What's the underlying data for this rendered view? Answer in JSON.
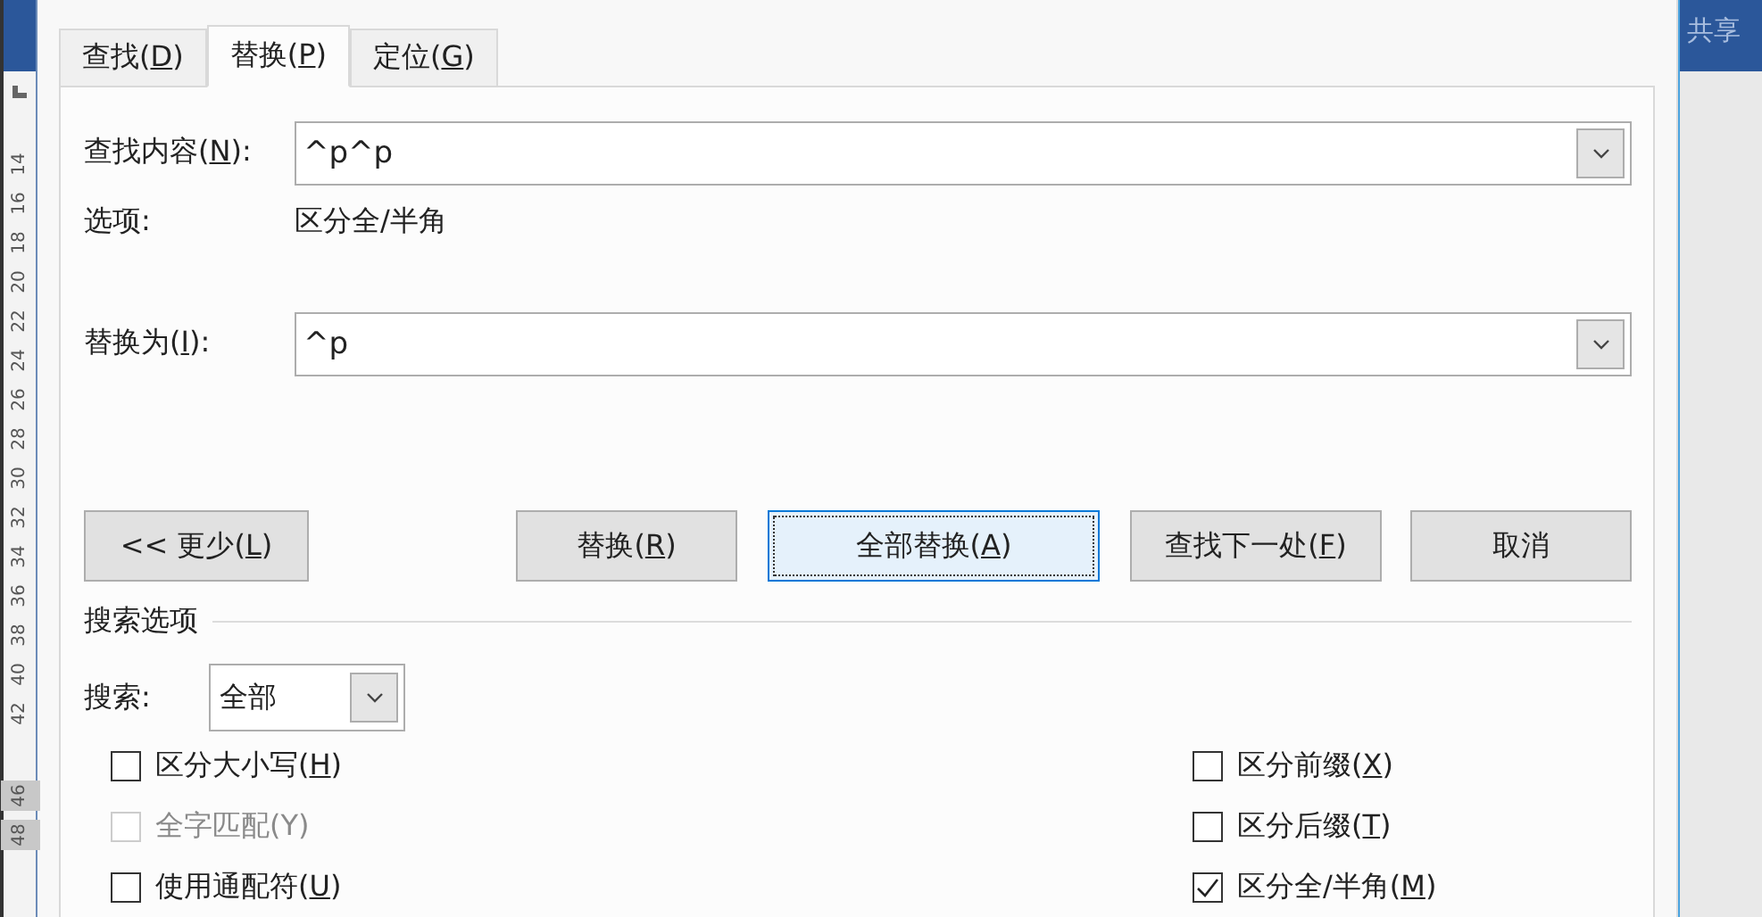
{
  "app_bar": {
    "share": "共享"
  },
  "ruler": [
    {
      "label": "14",
      "shaded": false
    },
    {
      "label": "16",
      "shaded": false
    },
    {
      "label": "18",
      "shaded": false
    },
    {
      "label": "20",
      "shaded": false
    },
    {
      "label": "22",
      "shaded": false
    },
    {
      "label": "24",
      "shaded": false
    },
    {
      "label": "26",
      "shaded": false
    },
    {
      "label": "28",
      "shaded": false
    },
    {
      "label": "30",
      "shaded": false
    },
    {
      "label": "32",
      "shaded": false
    },
    {
      "label": "34",
      "shaded": false
    },
    {
      "label": "36",
      "shaded": false
    },
    {
      "label": "38",
      "shaded": false
    },
    {
      "label": "40",
      "shaded": false
    },
    {
      "label": "42",
      "shaded": false
    },
    {
      "label": "46",
      "shaded": true
    },
    {
      "label": "48",
      "shaded": true
    }
  ],
  "tabs": [
    {
      "label": "查找(D)",
      "selected": false
    },
    {
      "label": "替换(P)",
      "selected": true
    },
    {
      "label": "定位(G)",
      "selected": false
    }
  ],
  "find": {
    "label": "查找内容(N):",
    "value": "^p^p"
  },
  "options": {
    "label": "选项:",
    "value": "区分全/半角"
  },
  "replace": {
    "label": "替换为(I):",
    "value": "^p"
  },
  "buttons": [
    {
      "label": "<< 更少(L)",
      "focused": false
    },
    {
      "label": "替换(R)",
      "focused": false
    },
    {
      "label": "全部替换(A)",
      "focused": true
    },
    {
      "label": "查找下一处(F)",
      "focused": false
    },
    {
      "label": "取消",
      "focused": false
    }
  ],
  "search_options": {
    "heading": "搜索选项",
    "search_label": "搜索:",
    "search_value": "全部"
  },
  "checkboxes_left": [
    {
      "label": "区分大小写(H)",
      "checked": false,
      "disabled": false
    },
    {
      "label": "全字匹配(Y)",
      "checked": false,
      "disabled": true
    },
    {
      "label": "使用通配符(U)",
      "checked": false,
      "disabled": false
    }
  ],
  "checkboxes_right": [
    {
      "label": "区分前缀(X)",
      "checked": false,
      "disabled": false
    },
    {
      "label": "区分后缀(T)",
      "checked": false,
      "disabled": false
    },
    {
      "label": "区分全/半角(M)",
      "checked": true,
      "disabled": false
    }
  ]
}
